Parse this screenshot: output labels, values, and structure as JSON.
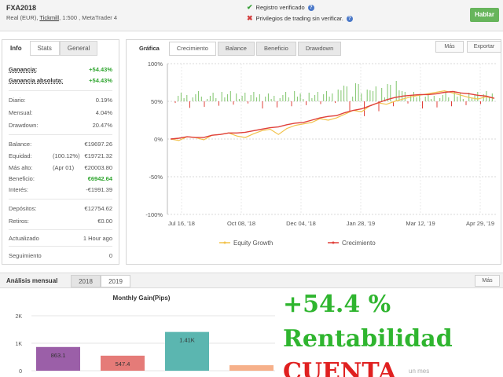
{
  "account": {
    "name": "FXA2018",
    "subtitle_pre": "Real (EUR), ",
    "broker": "Tickmill",
    "subtitle_post": ", 1:500 , MetaTrader 4"
  },
  "verification": {
    "registered": "Registro verificado",
    "privileges": "Privilegios de trading sin verificar."
  },
  "talk_button": "Hablar",
  "info": {
    "title": "Info",
    "tabs": [
      "Stats",
      "General"
    ],
    "rows": [
      {
        "label": "Ganancia:",
        "value": "+54.43%",
        "kind": "green-hl"
      },
      {
        "label": "Ganancia absoluta:",
        "value": "+54.43%",
        "kind": "green-hl"
      },
      {
        "label": "Diario:",
        "value": "0.19%"
      },
      {
        "label": "Mensual:",
        "value": "4.04%"
      },
      {
        "label": "Drawdown:",
        "value": "20.47%"
      },
      {
        "label": "Balance:",
        "value": "€19697.26"
      },
      {
        "label": "Equidad:",
        "mid": "(100.12%)",
        "value": "€19721.32"
      },
      {
        "label": "Más alto:",
        "mid": "(Apr 01)",
        "value": "€20003.80"
      },
      {
        "label": "Beneficio:",
        "value": "€6942.64",
        "kind": "green"
      },
      {
        "label": "Interés:",
        "value": "-€1991.39"
      },
      {
        "label": "Depósitos:",
        "value": "€12754.62"
      },
      {
        "label": "Retiros:",
        "value": "€0.00"
      },
      {
        "label": "Actualizado",
        "value": "1 Hour ago"
      },
      {
        "label": "Seguimiento",
        "value": "0"
      }
    ]
  },
  "chart_panel": {
    "title": "Gráfica",
    "tabs": [
      "Crecimiento",
      "Balance",
      "Beneficio",
      "Drawdown"
    ],
    "mas": "Más",
    "exportar": "Exportar"
  },
  "chart_data": {
    "type": "line",
    "y_ticks": [
      "100%",
      "50%",
      "0%",
      "-50%",
      "-100%"
    ],
    "ylim": [
      -100,
      100
    ],
    "x_ticks": [
      "Jul 16, '18",
      "Oct 08, '18",
      "Dec 04, '18",
      "Jan 28, '19",
      "Mar 12, '19",
      "Apr 29, '19"
    ],
    "grid": true,
    "legend": "bottom",
    "series": [
      {
        "name": "Equity Growth",
        "color": "#f2c24b",
        "values": [
          0,
          -2,
          3,
          2,
          -1,
          5,
          6,
          8,
          4,
          2,
          7,
          11,
          13,
          6,
          14,
          18,
          20,
          22,
          27,
          25,
          28,
          33,
          38,
          36,
          44,
          48,
          46,
          50,
          53,
          56,
          58,
          60,
          62,
          64,
          61,
          58,
          55,
          53,
          56,
          54
        ]
      },
      {
        "name": "Crecimiento",
        "color": "#e0403a",
        "values": [
          0,
          1,
          3,
          2,
          2,
          5,
          6,
          8,
          8,
          9,
          11,
          13,
          15,
          16,
          19,
          21,
          22,
          25,
          28,
          30,
          31,
          35,
          38,
          40,
          44,
          48,
          52,
          55,
          57,
          58,
          59,
          59,
          60,
          62,
          63,
          61,
          60,
          58,
          57,
          54
        ]
      }
    ],
    "bars_color": "#7ec46a",
    "bars_neg_color": "#e0403a"
  },
  "monthly": {
    "title": "Análisis mensual",
    "years": [
      "2018",
      "2019"
    ],
    "mas": "Más",
    "chart_title": "Monthly Gain(Pips)",
    "y_ticks": [
      "2K",
      "1K",
      "0"
    ],
    "bars": [
      {
        "label": "863.1",
        "value": 863.1,
        "color": "#9b5fa8"
      },
      {
        "label": "547.4",
        "value": 547.4,
        "color": "#e57b78"
      },
      {
        "label": "1.41K",
        "value": 1410,
        "color": "#5bb6b0"
      },
      {
        "label": "",
        "value": 200,
        "color": "#f6b08a"
      }
    ]
  },
  "promo": {
    "line1": "+54.4 %",
    "line2": "Rentabilidad",
    "line3": "CUENTA"
  },
  "faint_text": "un mes"
}
